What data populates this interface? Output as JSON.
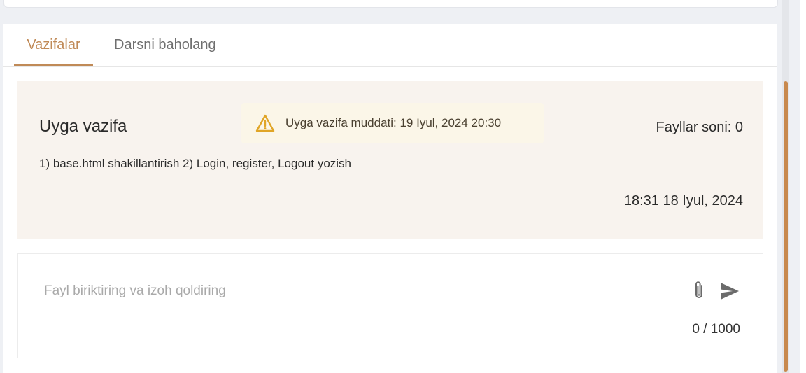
{
  "tabs": [
    {
      "label": "Vazifalar",
      "active": true
    },
    {
      "label": "Darsni baholang",
      "active": false
    }
  ],
  "homework": {
    "title": "Uyga vazifa",
    "deadline": "Uyga vazifa muddati: 19 Iyul, 2024 20:30",
    "files_count": "Fayllar soni: 0",
    "description": "1) base.html shakillantirish 2) Login, register, Logout yozish",
    "date": "18:31 18 Iyul, 2024"
  },
  "submit": {
    "placeholder": "Fayl biriktiring va izoh qoldiring",
    "value": "",
    "char_count": "0 / 1000"
  },
  "icons": {
    "warning": "warning-icon",
    "attach": "paperclip-icon",
    "send": "send-icon"
  },
  "colors": {
    "accent": "#c08a57",
    "panel_bg": "#f8f3ee",
    "deadline_bg": "#fbf6e8",
    "warning": "#e0a526",
    "scrollbar": "#c8894d"
  }
}
